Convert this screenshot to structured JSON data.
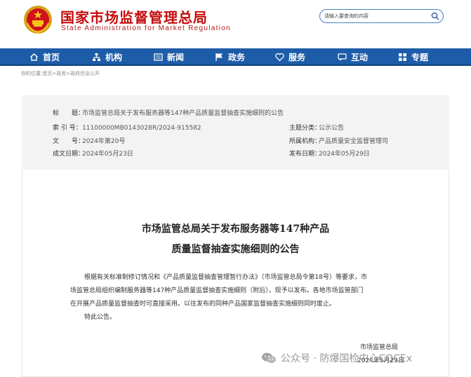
{
  "header": {
    "title_cn": "国家市场监督管理总局",
    "title_en": "State Administration for Market Regulation",
    "emblem": "national-emblem"
  },
  "search": {
    "placeholder": "请输入要查询的内容",
    "icon": "search-icon"
  },
  "nav": {
    "items": [
      {
        "label": "首页",
        "icon": "home-icon"
      },
      {
        "label": "机构",
        "icon": "org-icon"
      },
      {
        "label": "新闻",
        "icon": "news-icon"
      },
      {
        "label": "政务",
        "icon": "flag-icon"
      },
      {
        "label": "服务",
        "icon": "heart-icon"
      },
      {
        "label": "互动",
        "icon": "chat-icon"
      },
      {
        "label": "专题",
        "icon": "grid-icon"
      }
    ]
  },
  "breadcrumb": {
    "prefix": "你的位置:",
    "items": [
      "首页",
      "政务",
      "政府信息公开"
    ],
    "separator": " > "
  },
  "info": {
    "title_label": "标　　题：",
    "title_value": "市场监管总局关于发布服务器等147种产品质量监督抽查实施细则的公告",
    "index_label": "索 引 号：",
    "index_value": "11100000MB0143028R/2024-915582",
    "category_label": "主题分类：",
    "category_value": "公示公告",
    "doc_label": "文　　号：",
    "doc_value": "2024年第20号",
    "org_label": "所属机构：",
    "org_value": "产品质量安全监督管理司",
    "created_label": "成文日期：",
    "created_value": "2024年05月23日",
    "published_label": "发布日期：",
    "published_value": "2024年05月29日"
  },
  "article": {
    "title_line1": "市场监管总局关于发布服务器等147种产品",
    "title_line2": "质量监督抽查实施细则的公告",
    "para_line1": "根据有关标准制修订情况和《产品质量监督抽查管理暂行办法》（市场监管总局令第18号）等要求，市",
    "para_line2": "场监管总局组织编制服务器等147种产品质量监督抽查实施细则（附后），现予以发布。各地市场监管部门",
    "para_line3": "在开展产品质量监督抽查时可直接采用。以往发布的同种产品国家监督抽查实施细则同时废止。",
    "closing": "特此公告。",
    "signer": "市场监管总局",
    "sign_date": "2024年5月23日"
  },
  "watermark": {
    "text": "公众号 · 防爆国检中心CQCEx",
    "icon": "wechat-icon"
  },
  "colors": {
    "brand_red": "#c40c0c",
    "nav_blue": "#1d5ca8",
    "panel_gray": "#f3f3f3"
  }
}
